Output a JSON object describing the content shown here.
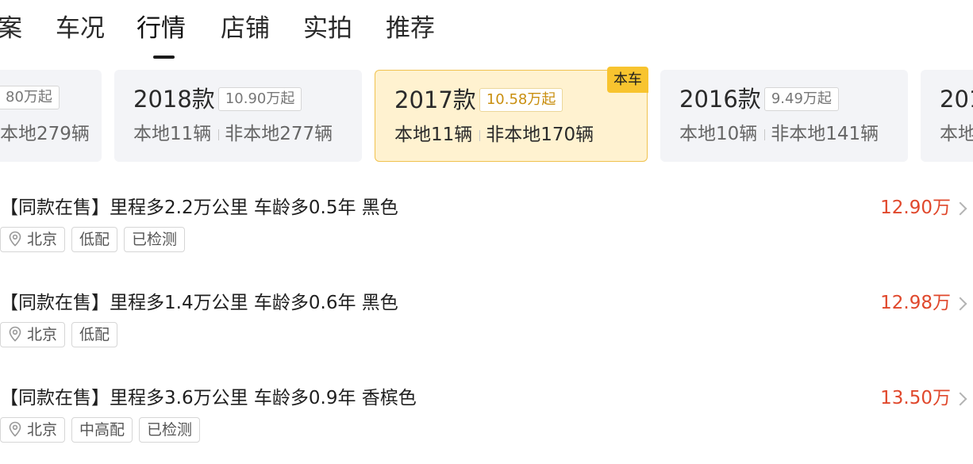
{
  "tabs": [
    {
      "label": "案"
    },
    {
      "label": "车况"
    },
    {
      "label": "行情"
    },
    {
      "label": "店铺"
    },
    {
      "label": "实拍"
    },
    {
      "label": "推荐"
    }
  ],
  "active_tab": "行情",
  "cards": [
    {
      "year": "",
      "price": "80万起",
      "local": "本地279辆",
      "nonlocal": ""
    },
    {
      "year": "2018款",
      "price": "10.90万起",
      "local": "本地11辆",
      "nonlocal": "非本地277辆"
    },
    {
      "year": "2017款",
      "price": "10.58万起",
      "local": "本地11辆",
      "nonlocal": "非本地170辆",
      "badge": "本车"
    },
    {
      "year": "2016款",
      "price": "9.49万起",
      "local": "本地10辆",
      "nonlocal": "非本地141辆"
    },
    {
      "year": "201",
      "price": "",
      "local": "本地",
      "nonlocal": ""
    }
  ],
  "listings": [
    {
      "title": "【同款在售】里程多2.2万公里 车龄多0.5年 黑色",
      "price": "12.90万",
      "location": "北京",
      "tags": [
        "低配",
        "已检测"
      ]
    },
    {
      "title": "【同款在售】里程多1.4万公里 车龄多0.6年 黑色",
      "price": "12.98万",
      "location": "北京",
      "tags": [
        "低配"
      ]
    },
    {
      "title": "【同款在售】里程多3.6万公里 车龄多0.9年 香槟色",
      "price": "13.50万",
      "location": "北京",
      "tags": [
        "中高配",
        "已检测"
      ]
    }
  ],
  "colors": {
    "price_red": "#e0482c",
    "badge_yellow": "#f8c42f",
    "current_card_bg": "#fff2d0"
  },
  "icons": {
    "location": "location-pin-icon",
    "chevron": "chevron-right-icon"
  }
}
